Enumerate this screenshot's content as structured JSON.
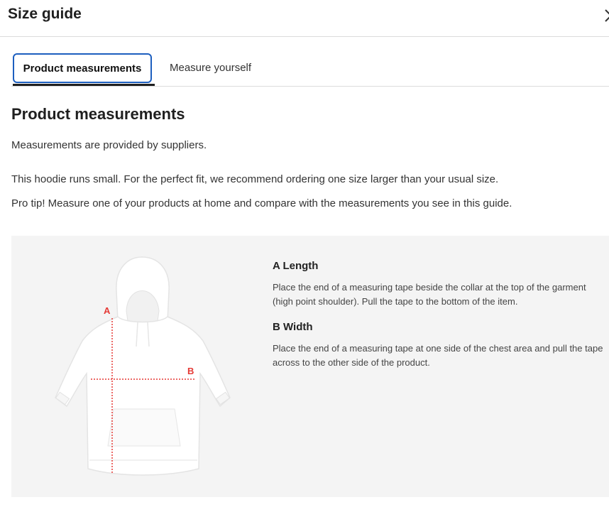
{
  "header": {
    "title": "Size guide"
  },
  "tabs": [
    {
      "label": "Product measurements",
      "active": true
    },
    {
      "label": "Measure yourself",
      "active": false
    }
  ],
  "content": {
    "heading": "Product measurements",
    "paragraphs": [
      "Measurements are provided by suppliers.",
      "This hoodie runs small. For the perfect fit, we recommend ordering one size larger than your usual size.",
      "Pro tip! Measure one of your products at home and compare with the measurements you see in this guide."
    ]
  },
  "diagram": {
    "label_a": "A",
    "label_b": "B",
    "marker_color": "#e53935"
  },
  "measurements": [
    {
      "title": "A Length",
      "description": "Place the end of a measuring tape beside the collar at the top of the garment (high point shoulder). Pull the tape to the bottom of the item."
    },
    {
      "title": "B Width",
      "description": "Place the end of a measuring tape at one side of the chest area and pull the tape across to the other side of the product."
    }
  ],
  "icons": {
    "close": "close-icon"
  },
  "colors": {
    "tab_border": "#1d5fbf",
    "panel_bg": "#f4f4f4"
  }
}
